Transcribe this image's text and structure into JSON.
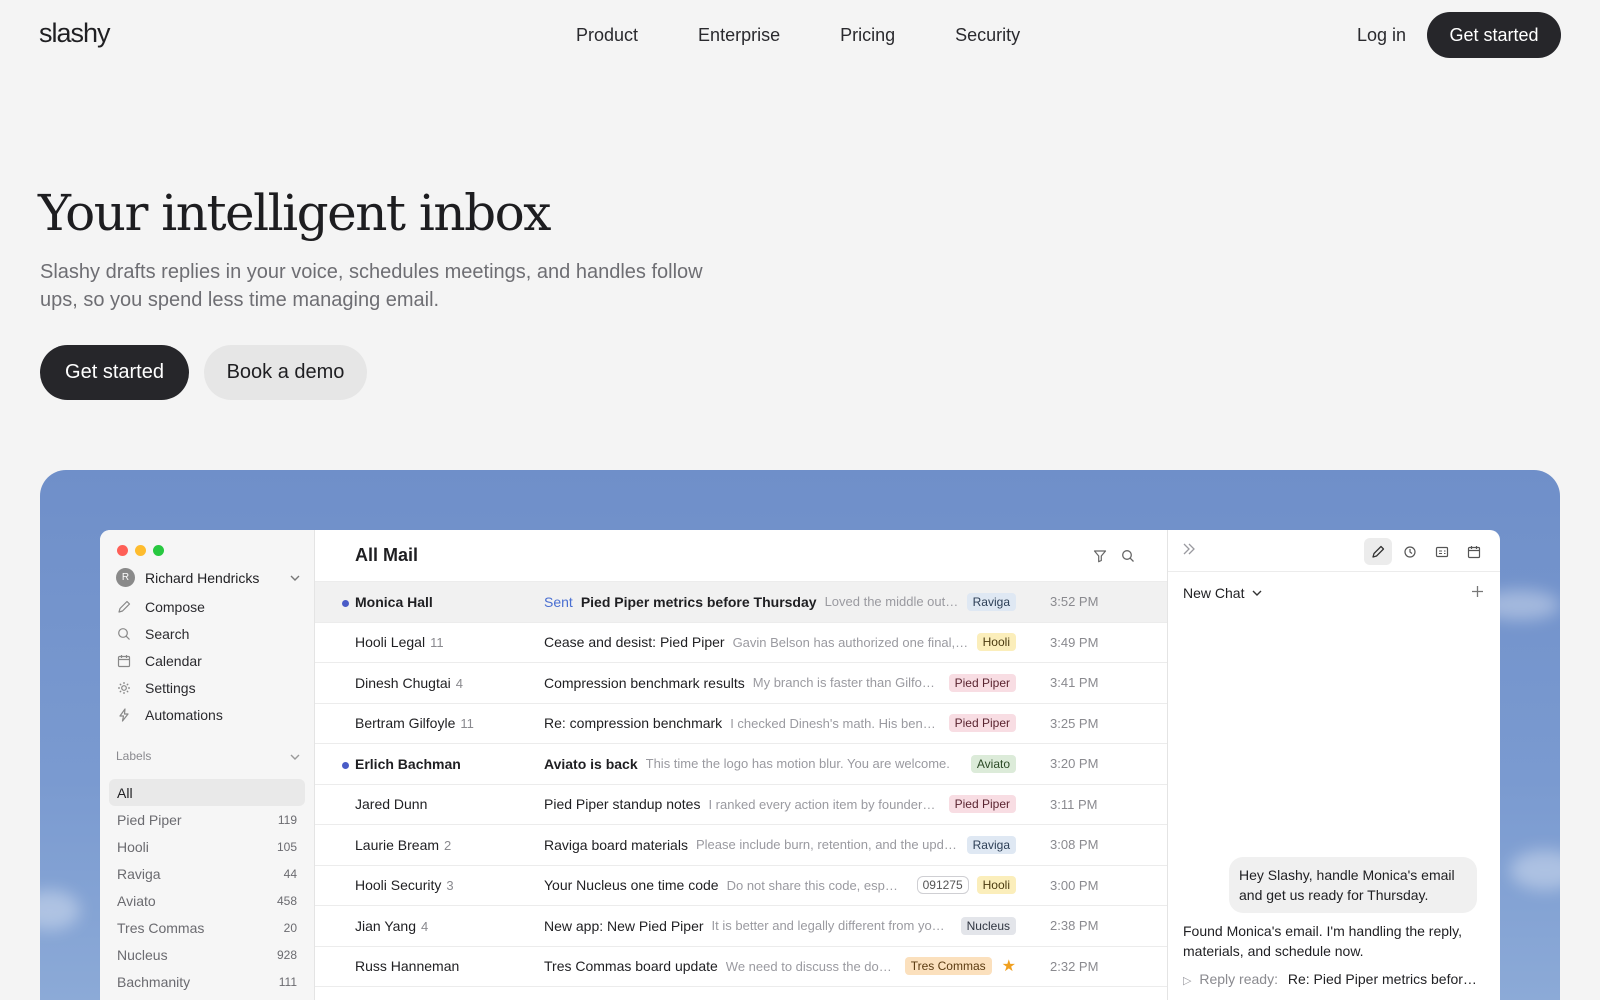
{
  "brand": {
    "logo": "slashy"
  },
  "nav": {
    "items": [
      "Product",
      "Enterprise",
      "Pricing",
      "Security"
    ],
    "login": "Log in",
    "cta": "Get started"
  },
  "hero": {
    "title": "Your intelligent inbox",
    "subtitle": "Slashy drafts replies in your voice, schedules meetings, and handles follow ups, so you spend less time managing email.",
    "primary": "Get started",
    "secondary": "Book a demo"
  },
  "app": {
    "traffic_colors": [
      "#fe5f57",
      "#febc2e",
      "#28c840"
    ],
    "user": {
      "initial": "R",
      "name": "Richard Hendricks"
    },
    "menu": [
      {
        "label": "Compose",
        "icon": "pencil-icon"
      },
      {
        "label": "Search",
        "icon": "search-icon"
      },
      {
        "label": "Calendar",
        "icon": "calendar-icon"
      },
      {
        "label": "Settings",
        "icon": "gear-icon"
      },
      {
        "label": "Automations",
        "icon": "bolt-icon"
      }
    ],
    "labels_title": "Labels",
    "labels": [
      {
        "name": "All",
        "count": ""
      },
      {
        "name": "Pied Piper",
        "count": "119"
      },
      {
        "name": "Hooli",
        "count": "105"
      },
      {
        "name": "Raviga",
        "count": "44"
      },
      {
        "name": "Aviato",
        "count": "458"
      },
      {
        "name": "Tres Commas",
        "count": "20"
      },
      {
        "name": "Nucleus",
        "count": "928"
      },
      {
        "name": "Bachmanity",
        "count": "111"
      }
    ],
    "mail_title": "All Mail",
    "emails": [
      {
        "sender": "Monica Hall",
        "count": "",
        "unread": true,
        "sent": "Sent",
        "subject": "Pied Piper metrics before Thursday",
        "subject_bold": true,
        "preview": "Loved the middle out …",
        "code": "",
        "tag": "Raviga",
        "starred": false,
        "time": "3:52 PM"
      },
      {
        "sender": "Hooli Legal",
        "count": "11",
        "unread": false,
        "sent": "",
        "subject": "Cease and desist: Pied Piper",
        "subject_bold": false,
        "preview": "Gavin Belson has authorized one final, …",
        "code": "",
        "tag": "Hooli",
        "starred": false,
        "time": "3:49 PM"
      },
      {
        "sender": "Dinesh Chugtai",
        "count": "4",
        "unread": false,
        "sent": "",
        "subject": "Compression benchmark results",
        "subject_bold": false,
        "preview": "My branch is faster than Gilfo…",
        "code": "",
        "tag": "Pied Piper",
        "starred": false,
        "time": "3:41 PM"
      },
      {
        "sender": "Bertram Gilfoyle",
        "count": "11",
        "unread": false,
        "sent": "",
        "subject": "Re: compression benchmark",
        "subject_bold": false,
        "preview": "I checked Dinesh's math. His ben…",
        "code": "",
        "tag": "Pied Piper",
        "starred": false,
        "time": "3:25 PM"
      },
      {
        "sender": "Erlich Bachman",
        "count": "",
        "unread": true,
        "sent": "",
        "subject": "Aviato is back",
        "subject_bold": true,
        "preview": "This time the logo has motion blur. You are welcome.",
        "code": "",
        "tag": "Aviato",
        "starred": false,
        "time": "3:20 PM"
      },
      {
        "sender": "Jared Dunn",
        "count": "",
        "unread": false,
        "sent": "",
        "subject": "Pied Piper standup notes",
        "subject_bold": false,
        "preview": "I ranked every action item by founder…",
        "code": "",
        "tag": "Pied Piper",
        "starred": false,
        "time": "3:11 PM"
      },
      {
        "sender": "Laurie Bream",
        "count": "2",
        "unread": false,
        "sent": "",
        "subject": "Raviga board materials",
        "subject_bold": false,
        "preview": "Please include burn, retention, and the upd…",
        "code": "",
        "tag": "Raviga",
        "starred": false,
        "time": "3:08 PM"
      },
      {
        "sender": "Hooli Security",
        "count": "3",
        "unread": false,
        "sent": "",
        "subject": "Your Nucleus one time code",
        "subject_bold": false,
        "preview": "Do not share this code, esp…",
        "code": "091275",
        "tag": "Hooli",
        "starred": false,
        "time": "3:00 PM"
      },
      {
        "sender": "Jian Yang",
        "count": "4",
        "unread": false,
        "sent": "",
        "subject": "New app: New Pied Piper",
        "subject_bold": false,
        "preview": "It is better and legally different from yo…",
        "code": "",
        "tag": "Nucleus",
        "starred": false,
        "time": "2:38 PM"
      },
      {
        "sender": "Russ Hanneman",
        "count": "",
        "unread": false,
        "sent": "",
        "subject": "Tres Commas board update",
        "subject_bold": false,
        "preview": "We need to discuss the doors a…",
        "code": "",
        "tag": "Tres Commas",
        "starred": true,
        "time": "2:32 PM"
      }
    ],
    "tag_colors": {
      "Raviga": {
        "bg": "#dfe8f3",
        "fg": "#2c3e55"
      },
      "Hooli": {
        "bg": "#fbeebb",
        "fg": "#4a3a10"
      },
      "Pied Piper": {
        "bg": "#f8dde3",
        "fg": "#5a2430"
      },
      "Aviato": {
        "bg": "#dcebd9",
        "fg": "#2c4a26"
      },
      "Nucleus": {
        "bg": "#e3e5ea",
        "fg": "#2e3440"
      },
      "Tres Commas": {
        "bg": "#fbe0bd",
        "fg": "#5a3a10"
      }
    },
    "chat": {
      "title": "New Chat",
      "user_message": "Hey Slashy, handle Monica's email and get us ready for Thursday.",
      "assistant_message": "Found Monica's email. I'm handling the reply, materials, and schedule now.",
      "reply_label": "Reply ready:",
      "reply_value": "Re: Pied Piper metrics before …"
    }
  }
}
